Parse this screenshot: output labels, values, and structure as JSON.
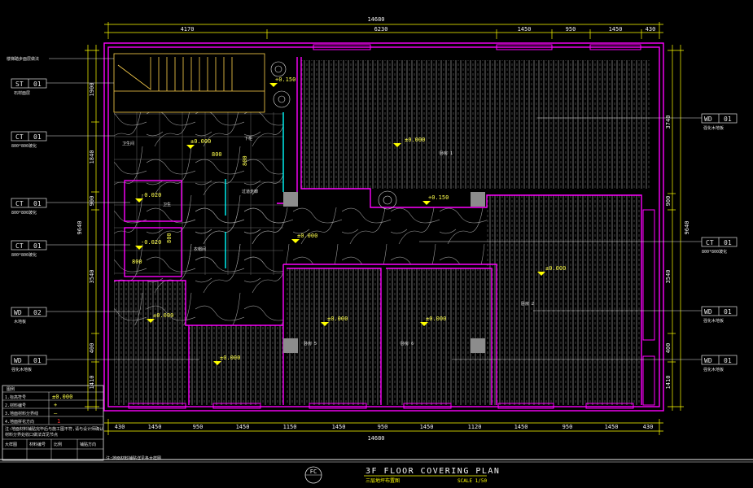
{
  "title": {
    "main": "3F FLOOR COVERING PLAN",
    "subtitle": "三层地坪布置图",
    "scale": "SCALE 1/50",
    "symbol": "FC"
  },
  "dims": {
    "top_total": "14680",
    "top_segments": [
      "4170",
      "6230",
      "1450",
      "950",
      "1450",
      "430"
    ],
    "bottom_total": "14680",
    "bottom_segments": [
      "430",
      "1450",
      "950",
      "1450",
      "1150",
      "1450",
      "950",
      "1450",
      "1120",
      "1450",
      "950",
      "1450",
      "430"
    ],
    "left_total": "9640",
    "left_segments": [
      "1900",
      "1840",
      "900",
      "3540",
      "400",
      "1410"
    ],
    "right_total": "9640",
    "right_segments": [
      "3740",
      "900",
      "3540",
      "400",
      "1410"
    ],
    "small_a": "800",
    "small_b": "800",
    "small_c": "800",
    "small_d": "800"
  },
  "tags": {
    "left": [
      {
        "code": "ST",
        "num": "01",
        "note": "石材面层"
      },
      {
        "code": "CT",
        "num": "01",
        "note": "800*800玻化"
      },
      {
        "code": "CT",
        "num": "01",
        "note": "800*800玻化"
      },
      {
        "code": "CT",
        "num": "01",
        "note": "800*800玻化"
      },
      {
        "code": "WD",
        "num": "02",
        "note": "木地板"
      },
      {
        "code": "WD",
        "num": "01",
        "note": "强化木地板"
      }
    ],
    "right": [
      {
        "code": "WD",
        "num": "01",
        "note": "强化木地板"
      },
      {
        "code": "CT",
        "num": "01",
        "note": "800*800玻化"
      },
      {
        "code": "WD",
        "num": "01",
        "note": "强化木地板"
      },
      {
        "code": "WD",
        "num": "01",
        "note": "强化木地板"
      }
    ],
    "top_note": "楼梯踏步面层做法"
  },
  "levels": [
    "±0.000",
    "±0.000",
    "-0.020",
    "-0.020",
    "±0.000",
    "±0.000",
    "±0.000",
    "±0.000",
    "±0.000",
    "±0.000",
    "+0.150",
    "+0.150"
  ],
  "rooms": {
    "bedroom_1": "卧房 1",
    "bedroom_2": "卧房 2",
    "bedroom_5": "卧房 5",
    "bedroom_6": "卧房 6",
    "bath_1": "卫生间",
    "bath_2": "卫生",
    "closet": "衣帽间",
    "corridor": "过道走廊",
    "cabinet": "下柜",
    "stair": "主卫淋浴"
  },
  "legend": {
    "header": "图例",
    "rows": [
      {
        "label": "1.标高符号",
        "symbol": "±0.000"
      },
      {
        "label": "2.材料编号",
        "symbol": "+"
      },
      {
        "label": "3.地面材料分界线",
        "symbol": "—"
      },
      {
        "label": "4.地面拼花方向",
        "symbol": "1"
      }
    ],
    "note1": "注:地面材料铺贴完毕后与施工图不符,请与设计师确认",
    "note2": "材料分界处收口做法详见节点",
    "footer": [
      "大样图",
      "材料编号",
      "比例",
      "铺贴方向"
    ]
  },
  "bottom_note": "注:地面材料铺贴详见各大样图",
  "colors": {
    "wall": "#ff00ff",
    "dimension": "#ffff00",
    "text": "#ffffff",
    "window": "#00ffff",
    "frame": "#ffffff"
  }
}
